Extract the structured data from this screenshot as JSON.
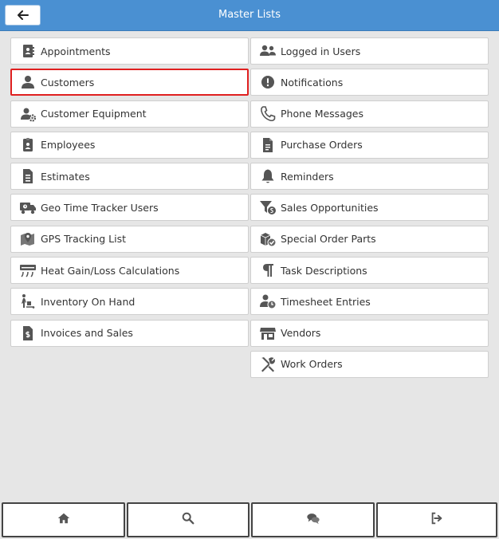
{
  "header": {
    "title": "Master Lists"
  },
  "lists": {
    "left": [
      {
        "label": "Appointments",
        "icon": "appointments-icon"
      },
      {
        "label": "Customers",
        "icon": "customer-icon",
        "selected": true
      },
      {
        "label": "Customer Equipment",
        "icon": "customer-equipment-icon"
      },
      {
        "label": "Employees",
        "icon": "employee-icon"
      },
      {
        "label": "Estimates",
        "icon": "estimate-icon"
      },
      {
        "label": "Geo Time Tracker Users",
        "icon": "geo-tracker-icon"
      },
      {
        "label": "GPS Tracking List",
        "icon": "gps-map-icon"
      },
      {
        "label": "Heat Gain/Loss Calculations",
        "icon": "hvac-icon"
      },
      {
        "label": "Inventory On Hand",
        "icon": "inventory-icon"
      },
      {
        "label": "Invoices and Sales",
        "icon": "invoice-icon"
      }
    ],
    "right": [
      {
        "label": "Logged in Users",
        "icon": "users-icon"
      },
      {
        "label": "Notifications",
        "icon": "exclamation-icon"
      },
      {
        "label": "Phone Messages",
        "icon": "phone-icon"
      },
      {
        "label": "Purchase Orders",
        "icon": "purchase-order-icon"
      },
      {
        "label": "Reminders",
        "icon": "bell-icon"
      },
      {
        "label": "Sales Opportunities",
        "icon": "funnel-dollar-icon"
      },
      {
        "label": "Special Order Parts",
        "icon": "box-check-icon"
      },
      {
        "label": "Task Descriptions",
        "icon": "paragraph-icon"
      },
      {
        "label": "Timesheet Entries",
        "icon": "user-clock-icon"
      },
      {
        "label": "Vendors",
        "icon": "store-icon"
      },
      {
        "label": "Work Orders",
        "icon": "tools-icon"
      }
    ]
  },
  "footer": [
    {
      "icon": "home-icon"
    },
    {
      "icon": "search-icon"
    },
    {
      "icon": "chat-icon"
    },
    {
      "icon": "sign-out-icon"
    }
  ],
  "colors": {
    "header": "#4a90d2",
    "selected_border": "#e02020",
    "background": "#e6e6e6"
  }
}
